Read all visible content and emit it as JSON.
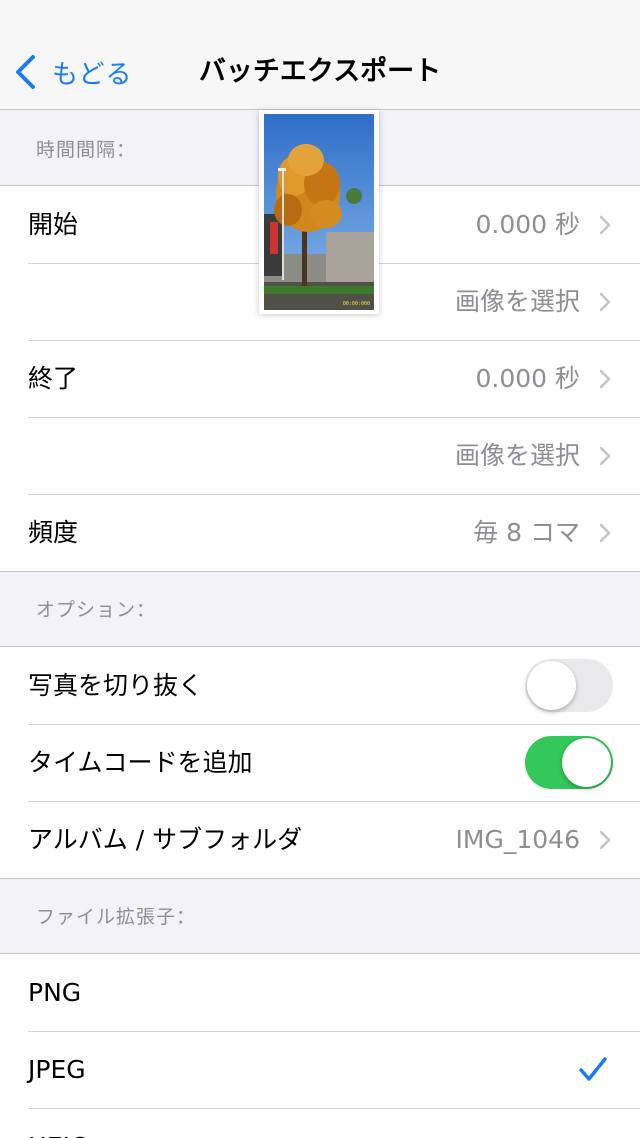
{
  "nav": {
    "back_label": "もどる",
    "title": "バッチエクスポート"
  },
  "interval": {
    "header": "時間間隔：",
    "rows": [
      {
        "label": "開始",
        "value": "0.000 秒"
      },
      {
        "label": "",
        "value": "画像を選択"
      },
      {
        "label": "終了",
        "value": "0.000 秒"
      },
      {
        "label": "",
        "value": "画像を選択"
      },
      {
        "label": "頻度",
        "value": "毎 8 コマ"
      }
    ]
  },
  "options": {
    "header": "オプション：",
    "crop_label": "写真を切り抜く",
    "crop_enabled": false,
    "timecode_label": "タイムコードを追加",
    "timecode_enabled": true,
    "album_label": "アルバム / サブフォルダ",
    "album_value": "IMG_1046"
  },
  "file_ext": {
    "header": "ファイル拡張子：",
    "items": [
      {
        "label": "PNG",
        "selected": false
      },
      {
        "label": "JPEG",
        "selected": true
      },
      {
        "label": "HEIC",
        "selected": false
      }
    ]
  },
  "preview": {
    "timecode": "00:00:000"
  },
  "colors": {
    "accent": "#1a7cf5",
    "toggle_on": "#34c759",
    "secondary_text": "#8e8e93",
    "background": "#f2f2f7"
  },
  "icons": [
    "chevron-left-icon",
    "chevron-right-icon",
    "checkmark-icon"
  ]
}
